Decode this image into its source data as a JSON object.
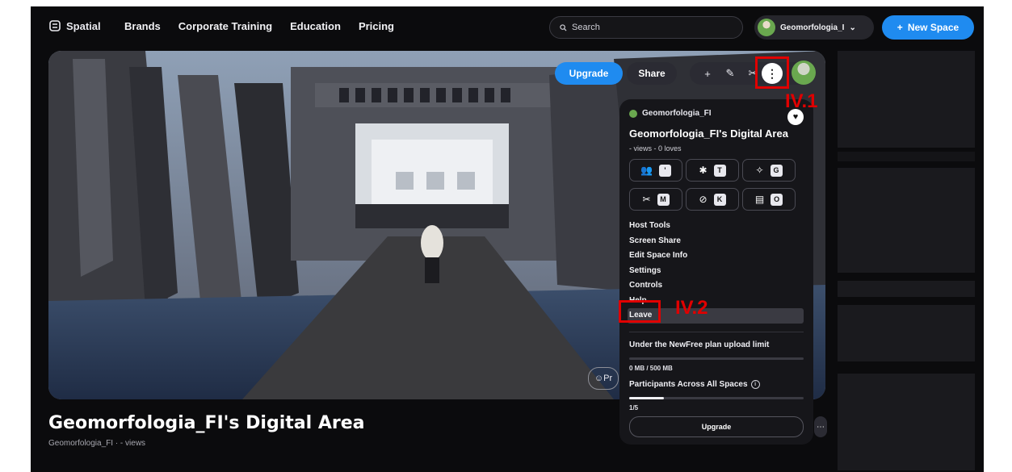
{
  "nav": {
    "logo": "Spatial",
    "links": [
      "Brands",
      "Corporate Training",
      "Education",
      "Pricing"
    ],
    "search_placeholder": "Search",
    "user": "Geomorfologia_I",
    "new_space": "New Space"
  },
  "viewport": {
    "upgrade": "Upgrade",
    "share": "Share",
    "toolbar_icons": [
      "+",
      "✎",
      "✂"
    ],
    "more": "⋮",
    "chip": "Pr"
  },
  "panel": {
    "owner": "Geomorfologia_FI",
    "title": "Geomorfologia_FI's Digital Area",
    "stats": "- views - 0 loves",
    "actions": [
      {
        "icon": "👥",
        "key": "'"
      },
      {
        "icon": "✱",
        "key": "T"
      },
      {
        "icon": "✧",
        "key": "G"
      },
      {
        "icon": "✂",
        "key": "M"
      },
      {
        "icon": "⊘",
        "key": "K"
      },
      {
        "icon": "▤",
        "key": "O"
      }
    ],
    "menu": [
      "Host Tools",
      "Screen Share",
      "Edit Space Info",
      "Settings",
      "Controls",
      "Help",
      "Leave"
    ],
    "limit_title": "Under the NewFree plan upload limit",
    "storage": "0 MB / 500 MB",
    "storage_fraction": 0.0,
    "participants_label": "Participants Across All Spaces",
    "participants": "1/5",
    "participants_fraction": 0.2,
    "upgrade": "Upgrade"
  },
  "page": {
    "space_title": "Geomorfologia_FI's Digital Area",
    "subtitle": "Geomorfologia_FI · - views"
  },
  "annotations": {
    "a1": "IV.1",
    "a2": "IV.2",
    "color": "#e00000"
  }
}
